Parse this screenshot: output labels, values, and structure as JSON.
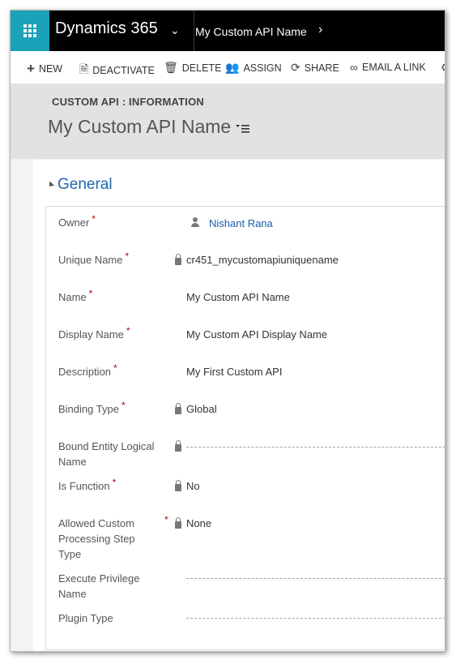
{
  "app": {
    "brand": "Dynamics 365",
    "breadcrumb": "My Custom API Name"
  },
  "commands": [
    {
      "label": "NEW",
      "icon": "plus-icon"
    },
    {
      "label": "DEACTIVATE",
      "icon": "deactivate-icon"
    },
    {
      "label": "DELETE",
      "icon": "trash-icon"
    },
    {
      "label": "ASSIGN",
      "icon": "assign-icon"
    },
    {
      "label": "SHARE",
      "icon": "share-icon"
    },
    {
      "label": "EMAIL A LINK",
      "icon": "link-icon"
    }
  ],
  "header": {
    "entity_type": "CUSTOM API : INFORMATION",
    "record_title": "My Custom API Name"
  },
  "section": {
    "title": "General"
  },
  "fields": {
    "owner": {
      "label": "Owner",
      "value": "Nishant Rana",
      "required": "*"
    },
    "unique_name": {
      "label": "Unique Name",
      "value": "cr451_mycustomapiuniquename",
      "required": "*"
    },
    "name": {
      "label": "Name",
      "value": "My Custom API Name",
      "required": "*"
    },
    "display_name": {
      "label": "Display Name",
      "value": "My Custom API Display Name",
      "required": "*"
    },
    "description": {
      "label": "Description",
      "value": "My First Custom API",
      "required": "*"
    },
    "binding_type": {
      "label": "Binding Type",
      "value": "Global",
      "required": "*"
    },
    "bound_entity": {
      "label_line1": "Bound Entity Logical",
      "label_line2": "Name",
      "value": ""
    },
    "is_function": {
      "label": "Is Function",
      "value": "No",
      "required": "*"
    },
    "allowed_step": {
      "label_line1": "Allowed Custom",
      "label_line2": "Processing Step",
      "label_line3": "Type",
      "value": "None",
      "required": "*"
    },
    "execute_privilege": {
      "label_line1": "Execute Privilege",
      "label_line2": "Name",
      "value": ""
    },
    "plugin_type": {
      "label": "Plugin Type",
      "value": ""
    }
  },
  "colors": {
    "waffle_bg": "#1ba1b8",
    "topbar_bg": "#000000",
    "link": "#1a5fa8",
    "required": "#c00000"
  }
}
